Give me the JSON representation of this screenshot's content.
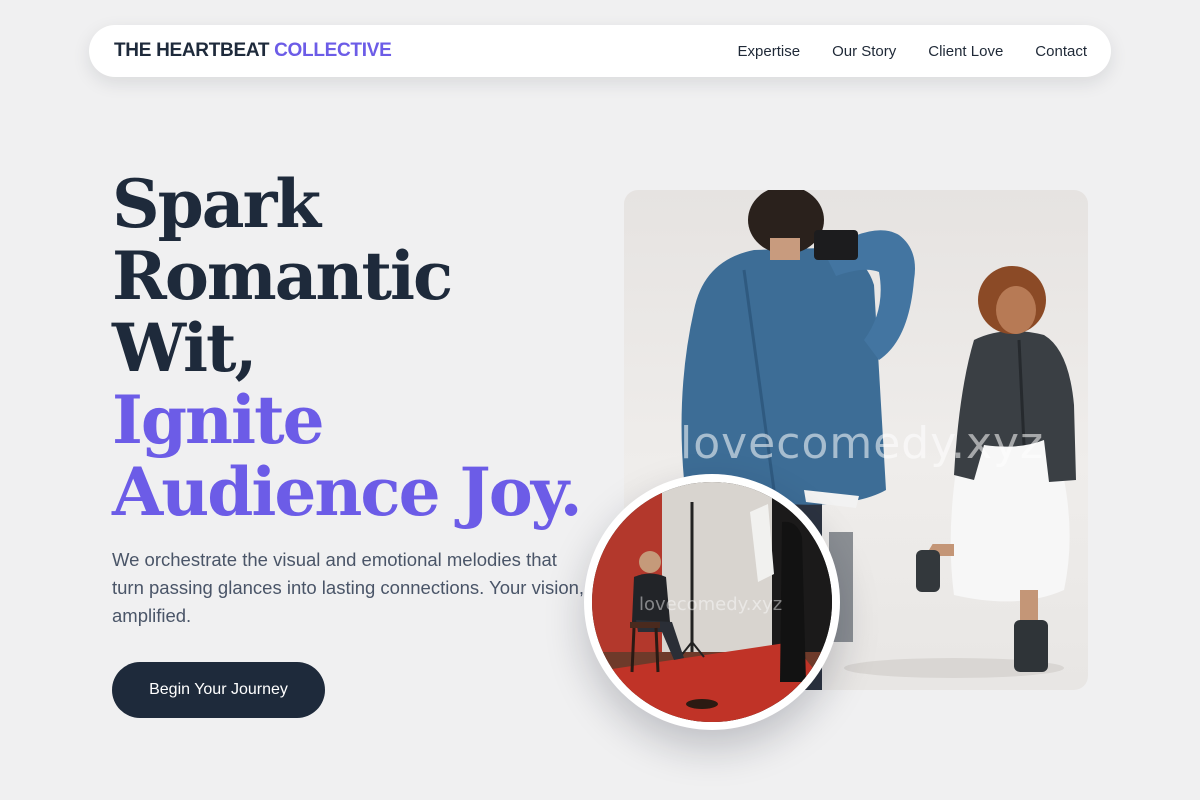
{
  "nav": {
    "brand_main": "THE HEARTBEAT",
    "brand_accent": "COLLECTIVE",
    "links": [
      "Expertise",
      "Our Story",
      "Client Love",
      "Contact"
    ]
  },
  "hero": {
    "title_lines_dark": [
      "Spark",
      "Romantic",
      "Wit,"
    ],
    "title_lines_accent": [
      "Ignite",
      "Audience Joy."
    ],
    "lead": "We orchestrate the visual and emotional melodies that turn passing glances into lasting connections. Your vision, amplified.",
    "cta_label": "Begin Your Journey"
  },
  "images": {
    "main_watermark": "lovecomedy.xyz",
    "circle_watermark": "lovecomedy.xyz"
  },
  "colors": {
    "background": "#f0f0f1",
    "text_dark": "#1e2a3b",
    "accent": "#6c5ce7",
    "button": "#1e2a3b"
  }
}
